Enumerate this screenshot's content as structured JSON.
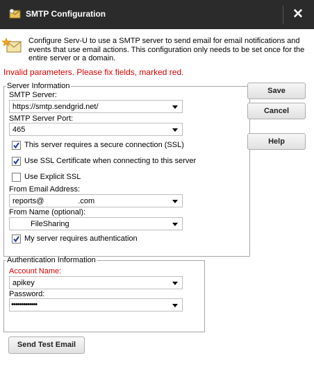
{
  "titlebar": {
    "title": "SMTP Configuration",
    "close_label": "✕"
  },
  "info": {
    "message": "Configure Serv-U to use a SMTP server to send email for email notifications and events that use email actions. This configuration only needs to be set once for the entire server or a domain."
  },
  "error": {
    "message": "Invalid parameters. Please fix fields, marked red."
  },
  "server_info": {
    "legend": "Server Information",
    "smtp_server_label": "SMTP Server:",
    "smtp_server_value": "https://smtp.sendgrid.net/",
    "smtp_port_label": "SMTP Server Port:",
    "smtp_port_value": "465",
    "secure_connection_label": "This server requires a secure connection (SSL)",
    "secure_connection_checked": true,
    "ssl_certificate_label": "Use SSL Certificate when connecting to this server",
    "ssl_certificate_checked": true,
    "explicit_ssl_label": "Use Explicit SSL",
    "explicit_ssl_checked": false,
    "from_email_label": "From Email Address:",
    "from_email_value": "reports@                .com",
    "from_name_label": "From Name (optional):",
    "from_name_value": "FileSharing",
    "requires_auth_label": "My server requires authentication",
    "requires_auth_checked": true
  },
  "auth_info": {
    "legend": "Authentication Information",
    "account_name_label": "Account Name:",
    "account_name_value": "apikey",
    "password_label": "Password:",
    "password_value": "•••••••••••••"
  },
  "buttons": {
    "save": "Save",
    "cancel": "Cancel",
    "help": "Help",
    "send_test_email": "Send Test Email"
  },
  "colors": {
    "titlebar_bg": "#2b2b2b",
    "error_red": "#e00000",
    "checkmark": "#1f3a93"
  }
}
